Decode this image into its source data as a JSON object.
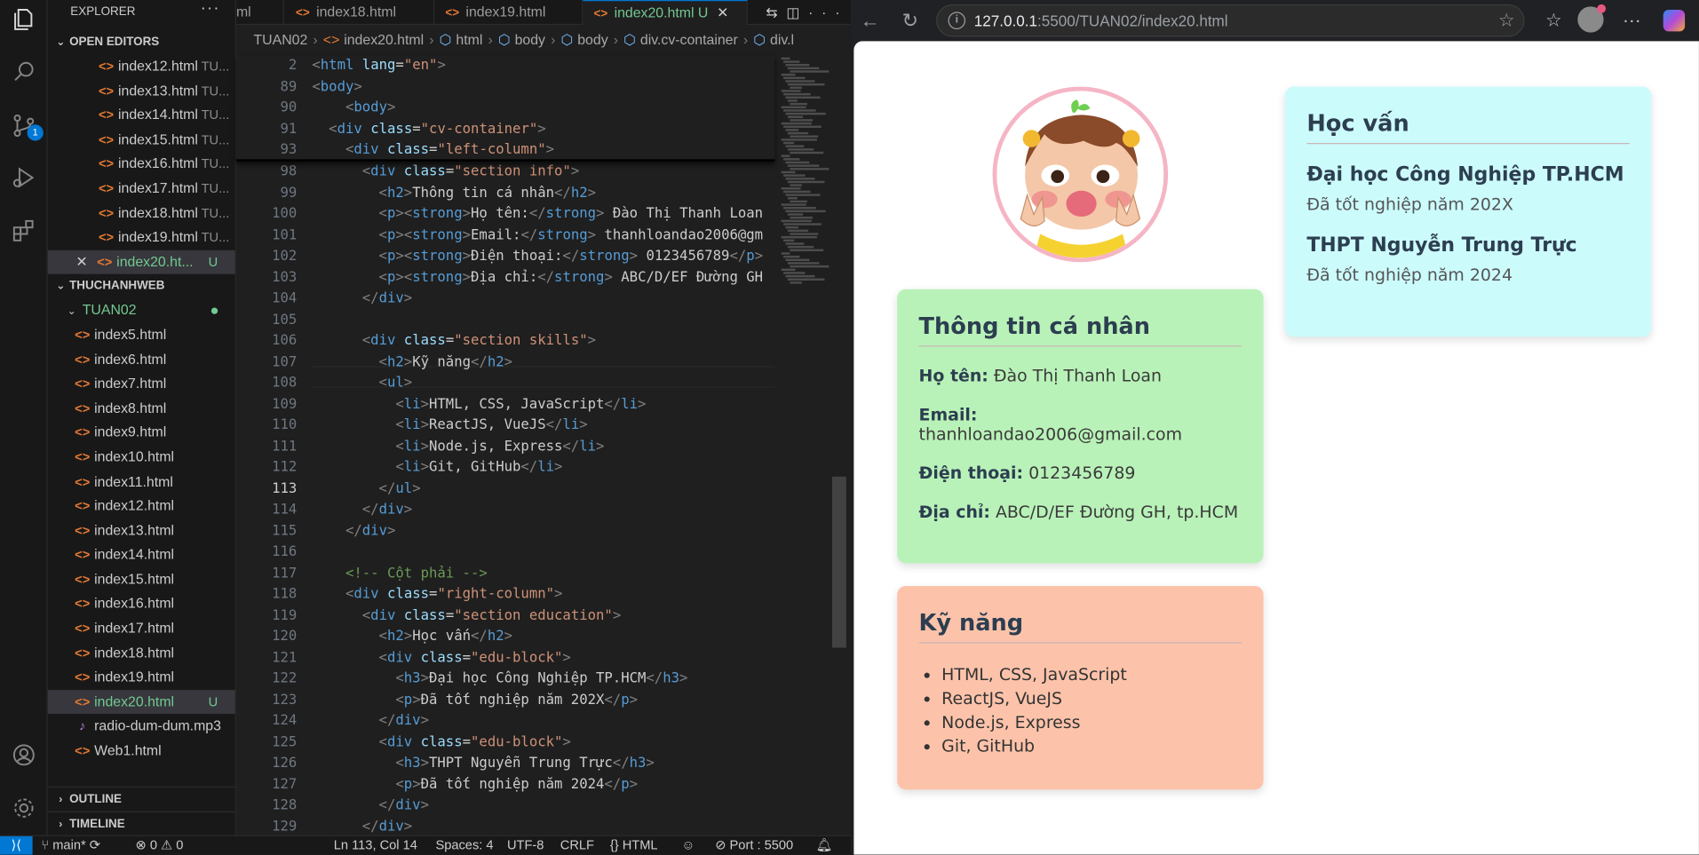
{
  "explorer": {
    "title": "EXPLORER",
    "open_editors_label": "OPEN EDITORS",
    "open_editors": [
      {
        "name": "index12.html",
        "tag": "TU..."
      },
      {
        "name": "index13.html",
        "tag": "TU..."
      },
      {
        "name": "index14.html",
        "tag": "TU..."
      },
      {
        "name": "index15.html",
        "tag": "TU..."
      },
      {
        "name": "index16.html",
        "tag": "TU..."
      },
      {
        "name": "index17.html",
        "tag": "TU..."
      },
      {
        "name": "index18.html",
        "tag": "TU..."
      },
      {
        "name": "index19.html",
        "tag": "TU..."
      },
      {
        "name": "index20.ht...",
        "tag": "U"
      }
    ],
    "workspace_label": "THUCHANHWEB",
    "folder_label": "TUAN02",
    "files": [
      "index5.html",
      "index6.html",
      "index7.html",
      "index8.html",
      "index9.html",
      "index10.html",
      "index11.html",
      "index12.html",
      "index13.html",
      "index14.html",
      "index15.html",
      "index16.html",
      "index17.html",
      "index18.html",
      "index19.html",
      "index20.html",
      "radio-dum-dum.mp3",
      "Web1.html"
    ],
    "active_file_status": "U",
    "outline_label": "OUTLINE",
    "timeline_label": "TIMELINE",
    "badge_count": "1"
  },
  "tabs": [
    {
      "label": "ml"
    },
    {
      "label": "index18.html"
    },
    {
      "label": "index19.html"
    },
    {
      "label": "index20.html",
      "status": "U"
    }
  ],
  "breadcrumb": [
    "TUAN02",
    "index20.html",
    "html",
    "body",
    "body",
    "div.cv-container",
    "div.l"
  ],
  "code": {
    "sticky": [
      {
        "n": "2",
        "h": "<span class='b'>&lt;</span><span class='t'>html</span> <span class='a'>lang</span>=<span class='s'>\"en\"</span><span class='b'>&gt;</span>"
      },
      {
        "n": "89",
        "h": "<span class='b'>&lt;</span><span class='t'>body</span><span class='b'>&gt;</span>"
      },
      {
        "n": "90",
        "h": "    <span class='b'>&lt;</span><span class='t'>body</span><span class='b'>&gt;</span>"
      },
      {
        "n": "91",
        "h": "  <span class='b'>&lt;</span><span class='t'>div</span> <span class='a'>class</span>=<span class='s'>\"cv-container\"</span><span class='b'>&gt;</span>"
      },
      {
        "n": "93",
        "h": "    <span class='b'>&lt;</span><span class='t'>div</span> <span class='a'>class</span>=<span class='s'>\"left-column\"</span><span class='b'>&gt;</span>"
      }
    ],
    "lines": [
      {
        "n": "98",
        "h": "      <span class='b'>&lt;</span><span class='t'>div</span> <span class='a'>class</span>=<span class='s'>\"section info\"</span><span class='b'>&gt;</span>"
      },
      {
        "n": "99",
        "h": "        <span class='b'>&lt;</span><span class='t'>h2</span><span class='b'>&gt;</span>Thông tin cá nhân<span class='b'>&lt;/</span><span class='t'>h2</span><span class='b'>&gt;</span>"
      },
      {
        "n": "100",
        "h": "        <span class='b'>&lt;</span><span class='t'>p</span><span class='b'>&gt;&lt;</span><span class='t'>strong</span><span class='b'>&gt;</span>Họ tên:<span class='b'>&lt;/</span><span class='t'>strong</span><span class='b'>&gt;</span> Đào Thị Thanh Loan"
      },
      {
        "n": "101",
        "h": "        <span class='b'>&lt;</span><span class='t'>p</span><span class='b'>&gt;&lt;</span><span class='t'>strong</span><span class='b'>&gt;</span>Email:<span class='b'>&lt;/</span><span class='t'>strong</span><span class='b'>&gt;</span> thanhloandao2006@gm"
      },
      {
        "n": "102",
        "h": "        <span class='b'>&lt;</span><span class='t'>p</span><span class='b'>&gt;&lt;</span><span class='t'>strong</span><span class='b'>&gt;</span>Điện thoại:<span class='b'>&lt;/</span><span class='t'>strong</span><span class='b'>&gt;</span> 0123456789<span class='b'>&lt;/</span><span class='t'>p</span><span class='b'>&gt;</span>"
      },
      {
        "n": "103",
        "h": "        <span class='b'>&lt;</span><span class='t'>p</span><span class='b'>&gt;&lt;</span><span class='t'>strong</span><span class='b'>&gt;</span>Địa chỉ:<span class='b'>&lt;/</span><span class='t'>strong</span><span class='b'>&gt;</span> ABC/D/EF Đường GH"
      },
      {
        "n": "104",
        "h": "      <span class='b'>&lt;/</span><span class='t'>div</span><span class='b'>&gt;</span>"
      },
      {
        "n": "105",
        "h": ""
      },
      {
        "n": "106",
        "h": "      <span class='b'>&lt;</span><span class='t'>div</span> <span class='a'>class</span>=<span class='s'>\"section skills\"</span><span class='b'>&gt;</span>"
      },
      {
        "n": "107",
        "h": "        <span class='b'>&lt;</span><span class='t'>h2</span><span class='b'>&gt;</span>Kỹ năng<span class='b'>&lt;/</span><span class='t'>h2</span><span class='b'>&gt;</span>"
      },
      {
        "n": "108",
        "h": "        <span class='b'>&lt;</span><span class='t'>ul</span><span class='b'>&gt;</span>"
      },
      {
        "n": "109",
        "h": "          <span class='b'>&lt;</span><span class='t'>li</span><span class='b'>&gt;</span>HTML, CSS, JavaScript<span class='b'>&lt;/</span><span class='t'>li</span><span class='b'>&gt;</span>"
      },
      {
        "n": "110",
        "h": "          <span class='b'>&lt;</span><span class='t'>li</span><span class='b'>&gt;</span>ReactJS, VueJS<span class='b'>&lt;/</span><span class='t'>li</span><span class='b'>&gt;</span>"
      },
      {
        "n": "111",
        "h": "          <span class='b'>&lt;</span><span class='t'>li</span><span class='b'>&gt;</span>Node.js, Express<span class='b'>&lt;/</span><span class='t'>li</span><span class='b'>&gt;</span>"
      },
      {
        "n": "112",
        "h": "          <span class='b'>&lt;</span><span class='t'>li</span><span class='b'>&gt;</span>Git, GitHub<span class='b'>&lt;/</span><span class='t'>li</span><span class='b'>&gt;</span>"
      },
      {
        "n": "113",
        "h": "        <span class='b'>&lt;/</span><span class='t'>ul</span><span class='b'>&gt;</span>",
        "cur": true
      },
      {
        "n": "114",
        "h": "      <span class='b'>&lt;/</span><span class='t'>div</span><span class='b'>&gt;</span>"
      },
      {
        "n": "115",
        "h": "    <span class='b'>&lt;/</span><span class='t'>div</span><span class='b'>&gt;</span>"
      },
      {
        "n": "116",
        "h": ""
      },
      {
        "n": "117",
        "h": "    <span class='c'>&lt;!-- Cột phải --&gt;</span>"
      },
      {
        "n": "118",
        "h": "    <span class='b'>&lt;</span><span class='t'>div</span> <span class='a'>class</span>=<span class='s'>\"right-column\"</span><span class='b'>&gt;</span>"
      },
      {
        "n": "119",
        "h": "      <span class='b'>&lt;</span><span class='t'>div</span> <span class='a'>class</span>=<span class='s'>\"section education\"</span><span class='b'>&gt;</span>"
      },
      {
        "n": "120",
        "h": "        <span class='b'>&lt;</span><span class='t'>h2</span><span class='b'>&gt;</span>Học vấn<span class='b'>&lt;/</span><span class='t'>h2</span><span class='b'>&gt;</span>"
      },
      {
        "n": "121",
        "h": "        <span class='b'>&lt;</span><span class='t'>div</span> <span class='a'>class</span>=<span class='s'>\"edu-block\"</span><span class='b'>&gt;</span>"
      },
      {
        "n": "122",
        "h": "          <span class='b'>&lt;</span><span class='t'>h3</span><span class='b'>&gt;</span>Đại học Công Nghiệp TP.HCM<span class='b'>&lt;/</span><span class='t'>h3</span><span class='b'>&gt;</span>"
      },
      {
        "n": "123",
        "h": "          <span class='b'>&lt;</span><span class='t'>p</span><span class='b'>&gt;</span>Đã tốt nghiệp năm 202X<span class='b'>&lt;/</span><span class='t'>p</span><span class='b'>&gt;</span>"
      },
      {
        "n": "124",
        "h": "        <span class='b'>&lt;/</span><span class='t'>div</span><span class='b'>&gt;</span>"
      },
      {
        "n": "125",
        "h": "        <span class='b'>&lt;</span><span class='t'>div</span> <span class='a'>class</span>=<span class='s'>\"edu-block\"</span><span class='b'>&gt;</span>"
      },
      {
        "n": "126",
        "h": "          <span class='b'>&lt;</span><span class='t'>h3</span><span class='b'>&gt;</span>THPT Nguyễn Trung Trực<span class='b'>&lt;/</span><span class='t'>h3</span><span class='b'>&gt;</span>"
      },
      {
        "n": "127",
        "h": "          <span class='b'>&lt;</span><span class='t'>p</span><span class='b'>&gt;</span>Đã tốt nghiệp năm 2024<span class='b'>&lt;/</span><span class='t'>p</span><span class='b'>&gt;</span>"
      },
      {
        "n": "128",
        "h": "        <span class='b'>&lt;/</span><span class='t'>div</span><span class='b'>&gt;</span>"
      },
      {
        "n": "129",
        "h": "      <span class='b'>&lt;/</span><span class='t'>div</span><span class='b'>&gt;</span>"
      }
    ]
  },
  "statusbar": {
    "branch": "main*",
    "problems": "⊗ 0 ⚠ 0",
    "position": "Ln 113, Col 14",
    "spaces": "Spaces: 4",
    "encoding": "UTF-8",
    "eol": "CRLF",
    "language": "{} HTML",
    "port": "Port : 5500"
  },
  "browser": {
    "url_host": "127.0.0.1",
    "url_path": ":5500/TUAN02/index20.html"
  },
  "cv": {
    "info": {
      "title": "Thông tin cá nhân",
      "fields": [
        {
          "label": "Họ tên:",
          "value": "Đào Thị Thanh Loan"
        },
        {
          "label": "Email:",
          "value": "thanhloandao2006@gmail.com"
        },
        {
          "label": "Điện thoại:",
          "value": "0123456789"
        },
        {
          "label": "Địa chỉ:",
          "value": "ABC/D/EF Đường GH, tp.HCM"
        }
      ],
      "bg": "#b9f2b8"
    },
    "skills": {
      "title": "Kỹ năng",
      "items": [
        "HTML, CSS, JavaScript",
        "ReactJS, VueJS",
        "Node.js, Express",
        "Git, GitHub"
      ],
      "bg": "#fcc3aa"
    },
    "education": {
      "title": "Học vấn",
      "blocks": [
        {
          "school": "Đại học Công Nghiệp TP.HCM",
          "note": "Đã tốt nghiệp năm 202X"
        },
        {
          "school": "THPT Nguyễn Trung Trực",
          "note": "Đã tốt nghiệp năm 2024"
        }
      ],
      "bg": "#ccfbfc"
    }
  }
}
